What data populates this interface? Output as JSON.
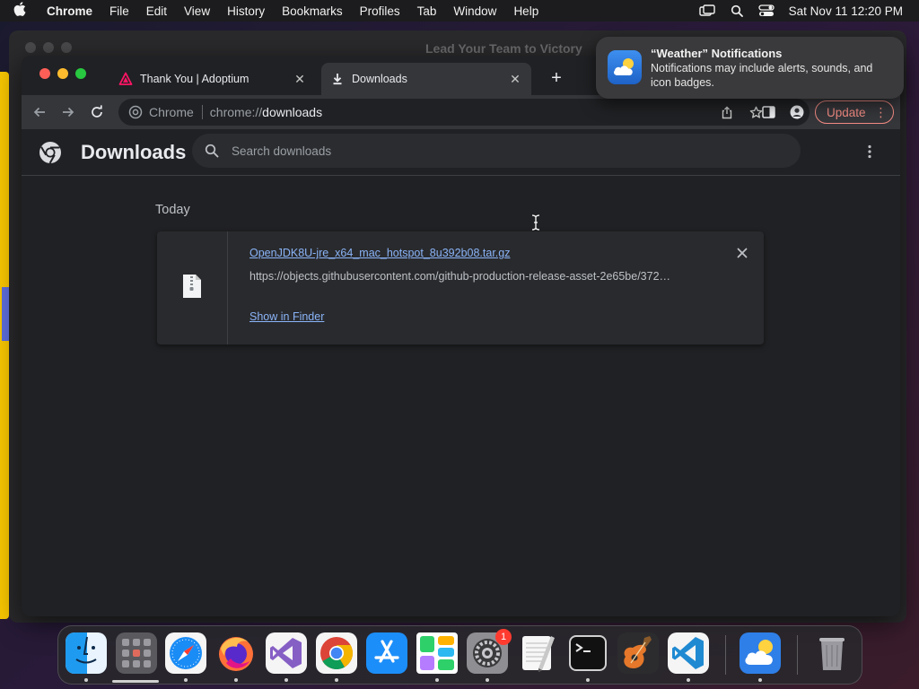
{
  "menubar": {
    "app_name": "Chrome",
    "items": [
      "File",
      "Edit",
      "View",
      "History",
      "Bookmarks",
      "Profiles",
      "Tab",
      "Window",
      "Help"
    ],
    "clock": "Sat Nov 11  12:20 PM"
  },
  "background_window": {
    "title": "Lead Your Team to Victory"
  },
  "tabs": [
    {
      "title": "Thank You | Adoptium",
      "icon": "adoptium-icon",
      "active": false
    },
    {
      "title": "Downloads",
      "icon": "download-icon",
      "active": true
    }
  ],
  "omnibox": {
    "scheme_label": "Chrome",
    "url_prefix": "chrome://",
    "url_host": "downloads"
  },
  "toolbar": {
    "update_label": "Update"
  },
  "downloads": {
    "title": "Downloads",
    "search_placeholder": "Search downloads",
    "section_label": "Today",
    "items": [
      {
        "file_name": "OpenJDK8U-jre_x64_mac_hotspot_8u392b08.tar.gz",
        "url": "https://objects.githubusercontent.com/github-production-release-asset-2e65be/372…",
        "action_label": "Show in Finder"
      }
    ]
  },
  "notification": {
    "title": "“Weather” Notifications",
    "body": "Notifications may include alerts, sounds, and icon badges."
  },
  "dock": {
    "apps": [
      "finder",
      "launchpad",
      "safari",
      "firefox",
      "visual-studio",
      "chrome",
      "app-store",
      "numbers",
      "system-settings",
      "textedit",
      "terminal",
      "garageband",
      "vscode",
      "weather",
      "trash"
    ],
    "system_settings_badge": "1"
  },
  "colors": {
    "accent_link": "#8ab4f8",
    "update_button": "#f28b82",
    "page_bg": "#202124",
    "toolbar_bg": "#35363a"
  }
}
